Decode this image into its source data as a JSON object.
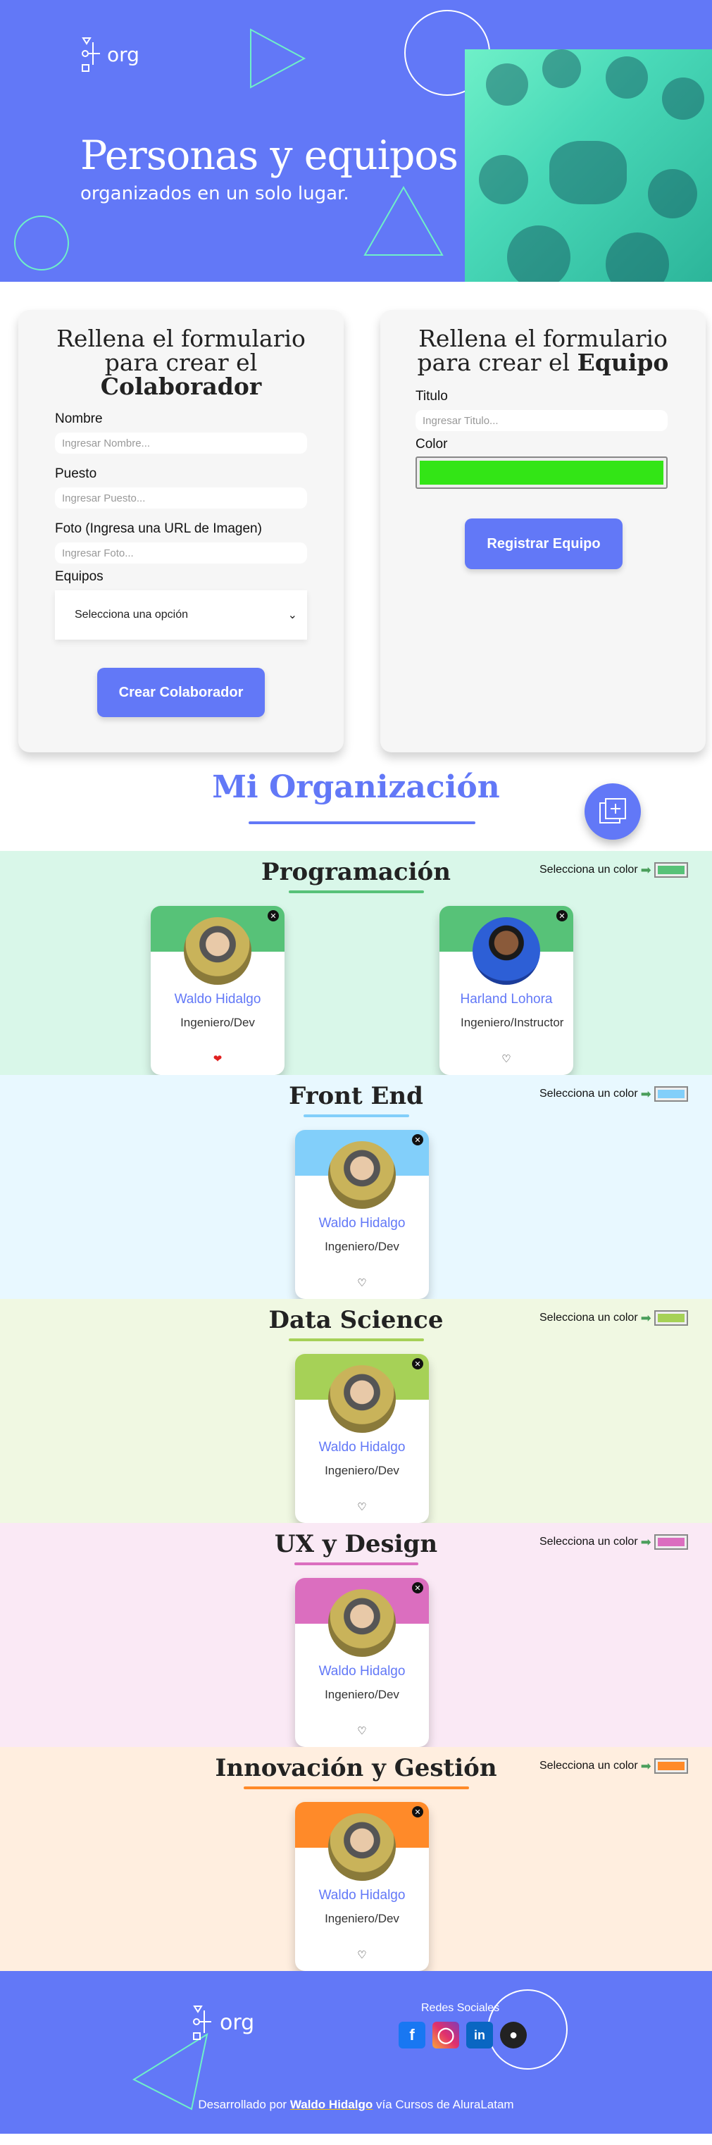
{
  "header": {
    "logo_text": "org",
    "title": "Personas y equipos",
    "subtitle": "organizados en un solo lugar."
  },
  "form_colaborador": {
    "title_line1": "Rellena el formulario",
    "title_line2": "para crear el",
    "title_bold": "Colaborador",
    "fields": [
      {
        "label": "Nombre",
        "placeholder": "Ingresar Nombre..."
      },
      {
        "label": "Puesto",
        "placeholder": "Ingresar Puesto..."
      },
      {
        "label": "Foto (Ingresa una URL de Imagen)",
        "placeholder": "Ingresar Foto..."
      }
    ],
    "select_label": "Equipos",
    "select_value": "Selecciona una opción",
    "button": "Crear Colaborador"
  },
  "form_equipo": {
    "title_line1": "Rellena el formulario",
    "title_line2": "para crear el",
    "title_bold": "Equipo",
    "title_label": "Titulo",
    "title_placeholder": "Ingresar Titulo...",
    "color_label": "Color",
    "color_value": "#33e516",
    "button": "Registrar Equipo"
  },
  "organization": {
    "title": "Mi Organización",
    "color_picker_label": "Selecciona un color"
  },
  "teams": [
    {
      "name": "Programación",
      "primary": "#57c278",
      "secondary": "#d9f7e9",
      "members": [
        {
          "name": "Waldo Hidalgo",
          "role": "Ingeniero/Dev",
          "favorite": true
        },
        {
          "name": "Harland Lohora",
          "role": "Ingeniero/Instructor",
          "favorite": false
        }
      ]
    },
    {
      "name": "Front End",
      "primary": "#82cffa",
      "secondary": "#e8f8ff",
      "members": [
        {
          "name": "Waldo Hidalgo",
          "role": "Ingeniero/Dev",
          "favorite": false
        }
      ]
    },
    {
      "name": "Data Science",
      "primary": "#a6d157",
      "secondary": "#f0f8e2",
      "members": [
        {
          "name": "Waldo Hidalgo",
          "role": "Ingeniero/Dev",
          "favorite": false
        }
      ]
    },
    {
      "name": "UX y Design",
      "primary": "#db6ebf",
      "secondary": "#fae9f5",
      "members": [
        {
          "name": "Waldo Hidalgo",
          "role": "Ingeniero/Dev",
          "favorite": false
        }
      ]
    },
    {
      "name": "Innovación y Gestión",
      "primary": "#ff8a29",
      "secondary": "#ffeedf",
      "members": [
        {
          "name": "Waldo Hidalgo",
          "role": "Ingeniero/Dev",
          "favorite": false
        }
      ]
    }
  ],
  "footer": {
    "logo_text": "org",
    "social_label": "Redes Sociales",
    "social_icons": [
      "facebook-icon",
      "instagram-icon",
      "linkedin-icon",
      "github-icon"
    ],
    "credit_prefix": "Desarrollado por",
    "credit_link": "Waldo Hidalgo",
    "credit_suffix": "vía Cursos de AluraLatam"
  },
  "colors": {
    "accent": "#6278f7",
    "hero_bg": "#6278f7",
    "deco_line": "#6ff0c8"
  }
}
